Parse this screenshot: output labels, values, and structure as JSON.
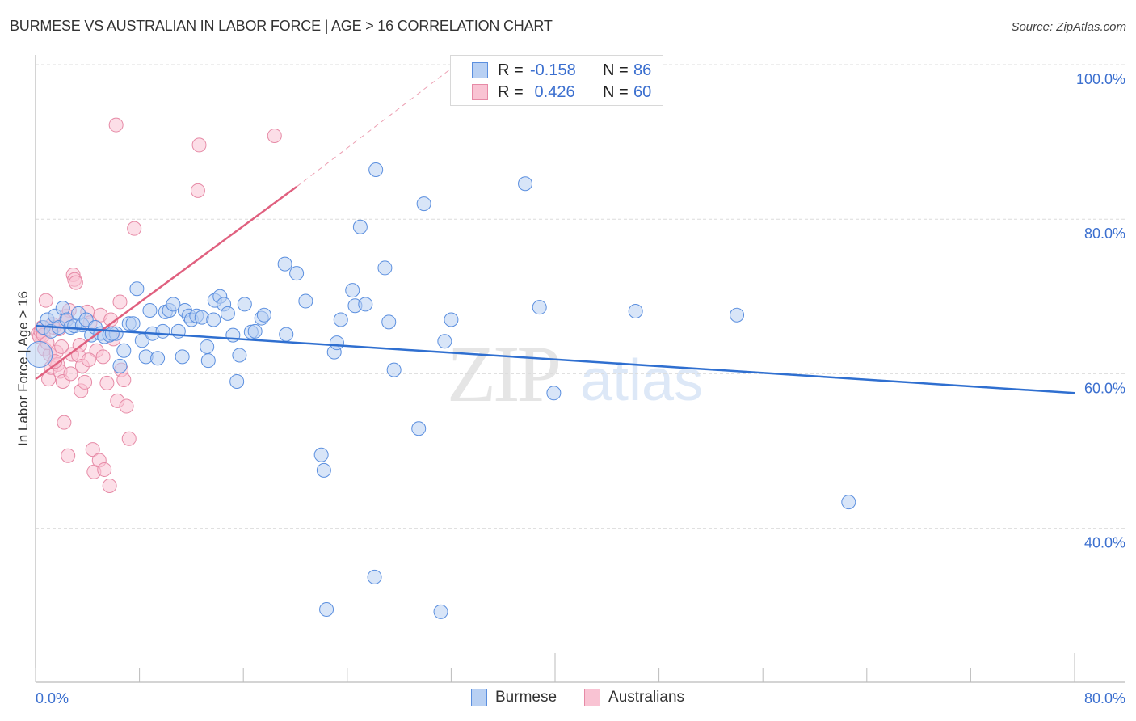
{
  "header": {
    "title": "BURMESE VS AUSTRALIAN IN LABOR FORCE | AGE > 16 CORRELATION CHART",
    "source": "Source: ZipAtlas.com"
  },
  "legend": {
    "rows": [
      {
        "r_label": "R =",
        "r_value": "-0.158",
        "n_label": "N =",
        "n_value": "86"
      },
      {
        "r_label": "R =",
        "r_value": " 0.426",
        "n_label": "N =",
        "n_value": "60"
      }
    ]
  },
  "bottom_legend": [
    "Burmese",
    "Australians"
  ],
  "watermark": {
    "zip": "ZIP",
    "atlas": "atlas"
  },
  "colors": {
    "burmese_fill": "#b8d0f3",
    "burmese_stroke": "#5b8fdf",
    "burmese_line": "#2f6fd0",
    "australians_fill": "#f9c3d3",
    "australians_stroke": "#e68aa6",
    "australians_line": "#e0607f",
    "tick_label": "#3b6fcf"
  },
  "chart_data": {
    "type": "scatter",
    "title": "BURMESE VS AUSTRALIAN IN LABOR FORCE | AGE > 16 CORRELATION CHART",
    "xlabel": "",
    "ylabel": "In Labor Force | Age > 16",
    "xlim": [
      0,
      80
    ],
    "ylim": [
      22.5,
      103
    ],
    "x_tick_labels": [
      "0.0%",
      "80.0%"
    ],
    "y_ticks": [
      100,
      80,
      60,
      40
    ],
    "y_tick_labels": [
      "100.0%",
      "80.0%",
      "60.0%",
      "40.0%"
    ],
    "grid": true,
    "legend_position": "top-center",
    "series": [
      {
        "name": "Burmese",
        "R": -0.158,
        "N": 86,
        "trend": {
          "x": [
            0,
            80
          ],
          "y": [
            66.2,
            57.5
          ]
        },
        "points": [
          [
            0.3,
            62.5
          ],
          [
            0.6,
            66.0
          ],
          [
            0.9,
            67.0
          ],
          [
            1.2,
            65.5
          ],
          [
            1.5,
            67.5
          ],
          [
            1.8,
            66.0
          ],
          [
            2.1,
            68.5
          ],
          [
            2.4,
            67.0
          ],
          [
            2.7,
            66.0
          ],
          [
            3.0,
            66.2
          ],
          [
            3.3,
            67.8
          ],
          [
            3.6,
            66.3
          ],
          [
            3.9,
            67.0
          ],
          [
            4.3,
            65.0
          ],
          [
            4.6,
            66.0
          ],
          [
            5.0,
            65.2
          ],
          [
            5.3,
            64.8
          ],
          [
            5.7,
            65.0
          ],
          [
            6.2,
            65.2
          ],
          [
            6.5,
            61.0
          ],
          [
            6.8,
            63.0
          ],
          [
            7.2,
            66.5
          ],
          [
            7.5,
            66.5
          ],
          [
            7.8,
            71.0
          ],
          [
            8.2,
            64.3
          ],
          [
            8.5,
            62.2
          ],
          [
            8.8,
            68.2
          ],
          [
            9.0,
            65.2
          ],
          [
            9.4,
            62.0
          ],
          [
            9.8,
            65.5
          ],
          [
            10.0,
            68.0
          ],
          [
            10.3,
            68.2
          ],
          [
            10.6,
            69.0
          ],
          [
            11.0,
            65.5
          ],
          [
            11.3,
            62.2
          ],
          [
            11.5,
            68.2
          ],
          [
            11.8,
            67.5
          ],
          [
            12.0,
            67.0
          ],
          [
            12.4,
            67.5
          ],
          [
            12.8,
            67.3
          ],
          [
            13.2,
            63.5
          ],
          [
            13.3,
            61.7
          ],
          [
            13.7,
            67.0
          ],
          [
            13.8,
            69.5
          ],
          [
            14.2,
            70.0
          ],
          [
            14.5,
            69.0
          ],
          [
            14.8,
            67.8
          ],
          [
            15.2,
            65.0
          ],
          [
            15.5,
            59.0
          ],
          [
            15.7,
            62.4
          ],
          [
            16.1,
            69.0
          ],
          [
            16.6,
            65.4
          ],
          [
            16.9,
            65.5
          ],
          [
            17.4,
            67.2
          ],
          [
            17.6,
            67.6
          ],
          [
            19.3,
            65.1
          ],
          [
            19.2,
            74.2
          ],
          [
            20.1,
            73.0
          ],
          [
            20.8,
            69.4
          ],
          [
            22.0,
            49.5
          ],
          [
            22.2,
            47.5
          ],
          [
            23.0,
            62.8
          ],
          [
            23.2,
            64.0
          ],
          [
            23.5,
            67.0
          ],
          [
            24.4,
            70.8
          ],
          [
            24.6,
            68.8
          ],
          [
            25.4,
            69.0
          ],
          [
            25.0,
            79.0
          ],
          [
            26.2,
            86.4
          ],
          [
            26.1,
            33.7
          ],
          [
            22.4,
            29.5
          ],
          [
            26.9,
            73.7
          ],
          [
            27.2,
            66.7
          ],
          [
            27.6,
            60.5
          ],
          [
            29.5,
            52.9
          ],
          [
            29.9,
            82.0
          ],
          [
            31.5,
            64.2
          ],
          [
            32.0,
            67.0
          ],
          [
            31.2,
            29.2
          ],
          [
            37.7,
            84.6
          ],
          [
            38.8,
            68.6
          ],
          [
            39.9,
            57.5
          ],
          [
            46.2,
            68.1
          ],
          [
            54.0,
            67.6
          ],
          [
            62.6,
            43.4
          ],
          [
            5.9,
            65.2
          ]
        ]
      },
      {
        "name": "Australians",
        "R": 0.426,
        "N": 60,
        "trend": {
          "x": [
            0,
            20.1
          ],
          "y": [
            59.3,
            84.2
          ],
          "dashed_to": {
            "x": 32.0,
            "y": 99.5
          }
        },
        "points": [
          [
            0.2,
            65.2
          ],
          [
            0.3,
            64.8
          ],
          [
            0.4,
            65.5
          ],
          [
            0.5,
            66.0
          ],
          [
            0.6,
            65.0
          ],
          [
            0.7,
            63.2
          ],
          [
            0.8,
            69.5
          ],
          [
            1.0,
            59.3
          ],
          [
            1.1,
            62.5
          ],
          [
            1.2,
            60.8
          ],
          [
            1.4,
            66.0
          ],
          [
            1.6,
            62.8
          ],
          [
            1.7,
            61.2
          ],
          [
            1.8,
            65.8
          ],
          [
            1.9,
            60.3
          ],
          [
            2.0,
            63.5
          ],
          [
            2.1,
            59.0
          ],
          [
            2.2,
            53.7
          ],
          [
            2.4,
            67.5
          ],
          [
            2.5,
            49.4
          ],
          [
            2.6,
            68.2
          ],
          [
            2.7,
            60.0
          ],
          [
            2.8,
            62.5
          ],
          [
            2.9,
            72.8
          ],
          [
            3.0,
            72.2
          ],
          [
            3.1,
            71.8
          ],
          [
            3.3,
            62.4
          ],
          [
            3.5,
            57.8
          ],
          [
            3.6,
            61.0
          ],
          [
            3.8,
            58.9
          ],
          [
            4.0,
            68.0
          ],
          [
            4.2,
            66.6
          ],
          [
            4.4,
            50.2
          ],
          [
            4.5,
            47.3
          ],
          [
            4.7,
            63.0
          ],
          [
            4.9,
            48.8
          ],
          [
            5.0,
            67.6
          ],
          [
            5.2,
            62.2
          ],
          [
            5.3,
            47.6
          ],
          [
            5.5,
            58.8
          ],
          [
            5.7,
            45.5
          ],
          [
            5.8,
            67.0
          ],
          [
            6.0,
            64.5
          ],
          [
            6.2,
            92.2
          ],
          [
            6.3,
            56.5
          ],
          [
            6.5,
            69.3
          ],
          [
            6.6,
            60.5
          ],
          [
            6.8,
            59.2
          ],
          [
            7.0,
            55.8
          ],
          [
            7.2,
            51.6
          ],
          [
            7.6,
            78.8
          ],
          [
            12.5,
            83.7
          ],
          [
            12.6,
            89.6
          ],
          [
            18.4,
            90.8
          ],
          [
            1.3,
            66.4
          ],
          [
            0.9,
            64.0
          ],
          [
            2.3,
            66.8
          ],
          [
            3.4,
            63.7
          ],
          [
            1.5,
            61.6
          ],
          [
            4.1,
            61.8
          ]
        ]
      }
    ]
  }
}
